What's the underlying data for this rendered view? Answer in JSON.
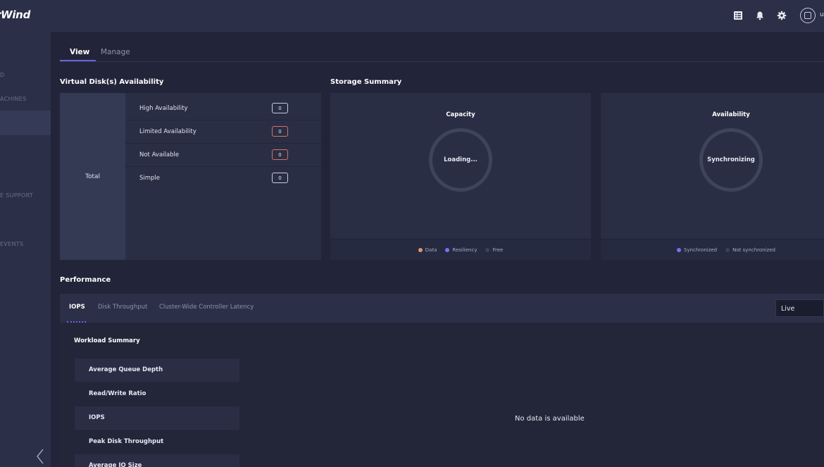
{
  "app": {
    "logo": "rWind"
  },
  "sidebar": {
    "items": [
      {
        "label": "D"
      },
      {
        "label": "ACHINES"
      },
      {
        "label": ""
      },
      {
        "label": "E SUPPORT"
      },
      {
        "label": "EVENTS"
      }
    ],
    "collapse_icon": "chevron-left-icon"
  },
  "topbar": {
    "icons": [
      "table-icon",
      "bell-icon",
      "gear-icon"
    ],
    "username": "u"
  },
  "view_tabs": [
    {
      "label": "View"
    },
    {
      "label": "Manage"
    }
  ],
  "virtual_disk": {
    "title": "Virtual Disk(s) Availability",
    "total_label": "Total",
    "rows": [
      {
        "label": "High Availability",
        "value": "0",
        "status_color": "#c7cbe2"
      },
      {
        "label": "Limited Availability",
        "value": "0",
        "status_color": "#d9715d"
      },
      {
        "label": "Not Available",
        "value": "0",
        "status_color": "#d9715d"
      },
      {
        "label": "Simple",
        "value": "0",
        "status_color": "#c7cbe2"
      }
    ]
  },
  "storage_summary": {
    "title": "Storage Summary",
    "capacity": {
      "title": "Capacity",
      "center": "Loading...",
      "legend": [
        {
          "label": "Data",
          "color": "#e0926a"
        },
        {
          "label": "Resiliency",
          "color": "#7b6ff0"
        },
        {
          "label": "Free",
          "color": "#3b3f57"
        }
      ]
    },
    "availability": {
      "title": "Availability",
      "center": "Synchronizing",
      "legend": [
        {
          "label": "Synchronized",
          "color": "#7b6ff0"
        },
        {
          "label": "Not synchronized",
          "color": "#3b3f57"
        }
      ]
    }
  },
  "performance": {
    "title": "Performance",
    "tabs": [
      {
        "label": "IOPS"
      },
      {
        "label": "Disk Throughput"
      },
      {
        "label": "Cluster-Wide Controller Latency"
      }
    ],
    "live_select": "Live",
    "workload_title": "Workload Summary",
    "metrics": [
      "Average Queue Depth",
      "Read/Write Ratio",
      "IOPS",
      "Peak Disk Throughput",
      "Average IO Size"
    ],
    "no_data": "No data is available"
  },
  "colors": {
    "accent": "#6c63d9",
    "warning": "#d9715d"
  }
}
